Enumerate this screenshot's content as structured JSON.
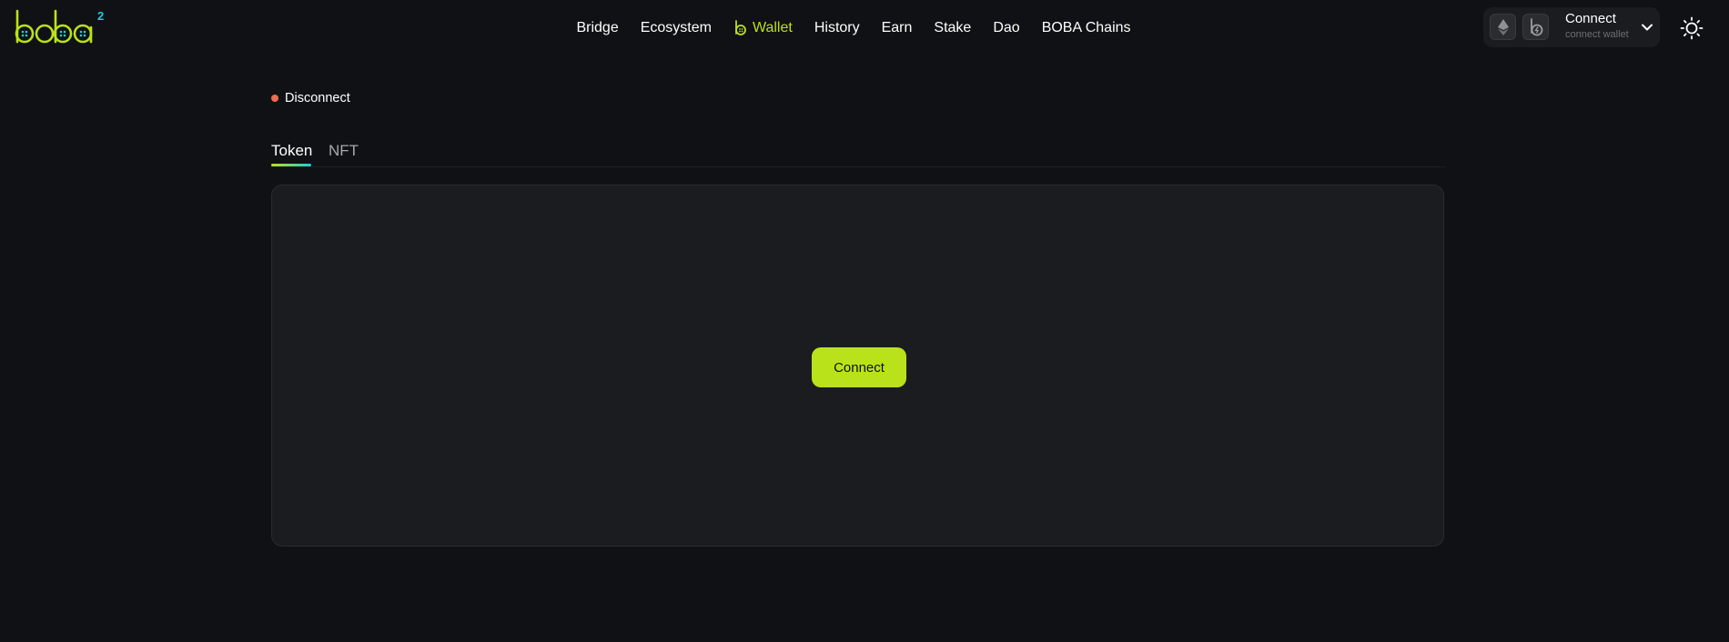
{
  "header": {
    "logo": {
      "text": "boba",
      "superscript": "2"
    },
    "nav": [
      {
        "label": "Bridge",
        "active": false
      },
      {
        "label": "Ecosystem",
        "active": false
      },
      {
        "label": "Wallet",
        "active": true,
        "icon": "boba-icon"
      },
      {
        "label": "History",
        "active": false
      },
      {
        "label": "Earn",
        "active": false
      },
      {
        "label": "Stake",
        "active": false
      },
      {
        "label": "Dao",
        "active": false
      },
      {
        "label": "BOBA Chains",
        "active": false
      }
    ],
    "wallet": {
      "title": "Connect",
      "subtitle": "connect wallet",
      "chains": [
        "ethereum-icon",
        "boba-chain-icon"
      ]
    },
    "theme_icon": "sun-icon"
  },
  "status": {
    "label": "Disconnect",
    "color": "#f26b4f"
  },
  "tabs": [
    {
      "label": "Token",
      "active": true
    },
    {
      "label": "NFT",
      "active": false
    }
  ],
  "panel": {
    "connect_label": "Connect"
  },
  "colors": {
    "accent": "#bae21a",
    "accent_secondary": "#1ccfd3",
    "background": "#101114",
    "panel": "#1b1c1f"
  }
}
